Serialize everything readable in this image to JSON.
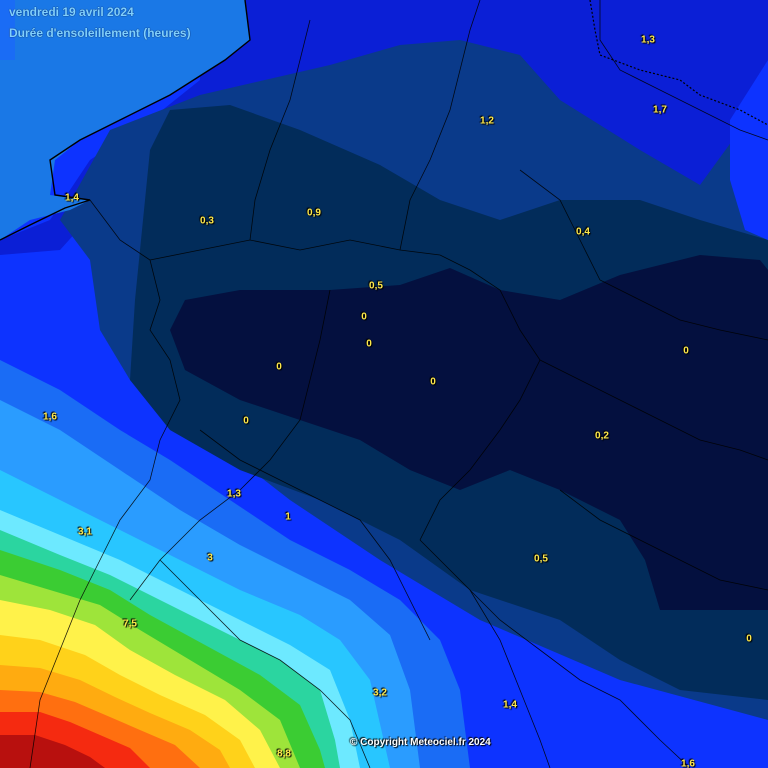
{
  "header": {
    "date": "vendredi 19 avril 2024",
    "title": "Durée d'ensoleillement (heures)"
  },
  "copyright": "© Copyright Meteociel.fr 2024",
  "colors": {
    "sea": "#1a78e6",
    "band_00": "#04103f",
    "band_03": "#022c5a",
    "band_09": "#0a3a8a",
    "band_12": "#0b1fd6",
    "band_15": "#0d33ff",
    "band_20": "#1a6cf5",
    "band_25": "#2a9cff",
    "band_30": "#28c6ff",
    "band_35": "#6de9ff",
    "band_40": "#2bd5a0",
    "band_45": "#3bcc33",
    "band_50": "#9ee43a",
    "band_60": "#fff24a",
    "band_70": "#ffd21a",
    "band_75": "#ffab10",
    "band_80": "#ff6f10",
    "band_85": "#f52a10",
    "band_90": "#b8100e",
    "label": "#ffe94a",
    "borders": "#000000"
  },
  "values": [
    {
      "id": "v-1-3-ne",
      "text": "1,3"
    },
    {
      "id": "v-1-2",
      "text": "1,2"
    },
    {
      "id": "v-1-7",
      "text": "1,7"
    },
    {
      "id": "v-1-4-nw",
      "text": "1,4"
    },
    {
      "id": "v-0-3",
      "text": "0,3"
    },
    {
      "id": "v-0-9",
      "text": "0,9"
    },
    {
      "id": "v-0-4",
      "text": "0,4"
    },
    {
      "id": "v-0-5-n",
      "text": "0,5"
    },
    {
      "id": "v-0-a",
      "text": "0"
    },
    {
      "id": "v-0-b",
      "text": "0"
    },
    {
      "id": "v-0-c",
      "text": "0"
    },
    {
      "id": "v-0-d",
      "text": "0"
    },
    {
      "id": "v-0-e",
      "text": "0"
    },
    {
      "id": "v-0-f",
      "text": "0"
    },
    {
      "id": "v-1-6-w",
      "text": "1,6"
    },
    {
      "id": "v-0-2",
      "text": "0,2"
    },
    {
      "id": "v-1-3-c",
      "text": "1,3"
    },
    {
      "id": "v-1",
      "text": "1"
    },
    {
      "id": "v-3-1",
      "text": "3,1"
    },
    {
      "id": "v-3",
      "text": "3"
    },
    {
      "id": "v-0-5-s",
      "text": "0,5"
    },
    {
      "id": "v-0-g",
      "text": "0"
    },
    {
      "id": "v-7-5",
      "text": "7,5"
    },
    {
      "id": "v-3-2",
      "text": "3,2"
    },
    {
      "id": "v-1-4-s",
      "text": "1,4"
    },
    {
      "id": "v-8-8",
      "text": "8,8"
    },
    {
      "id": "v-1-6-s",
      "text": "1,6"
    }
  ]
}
